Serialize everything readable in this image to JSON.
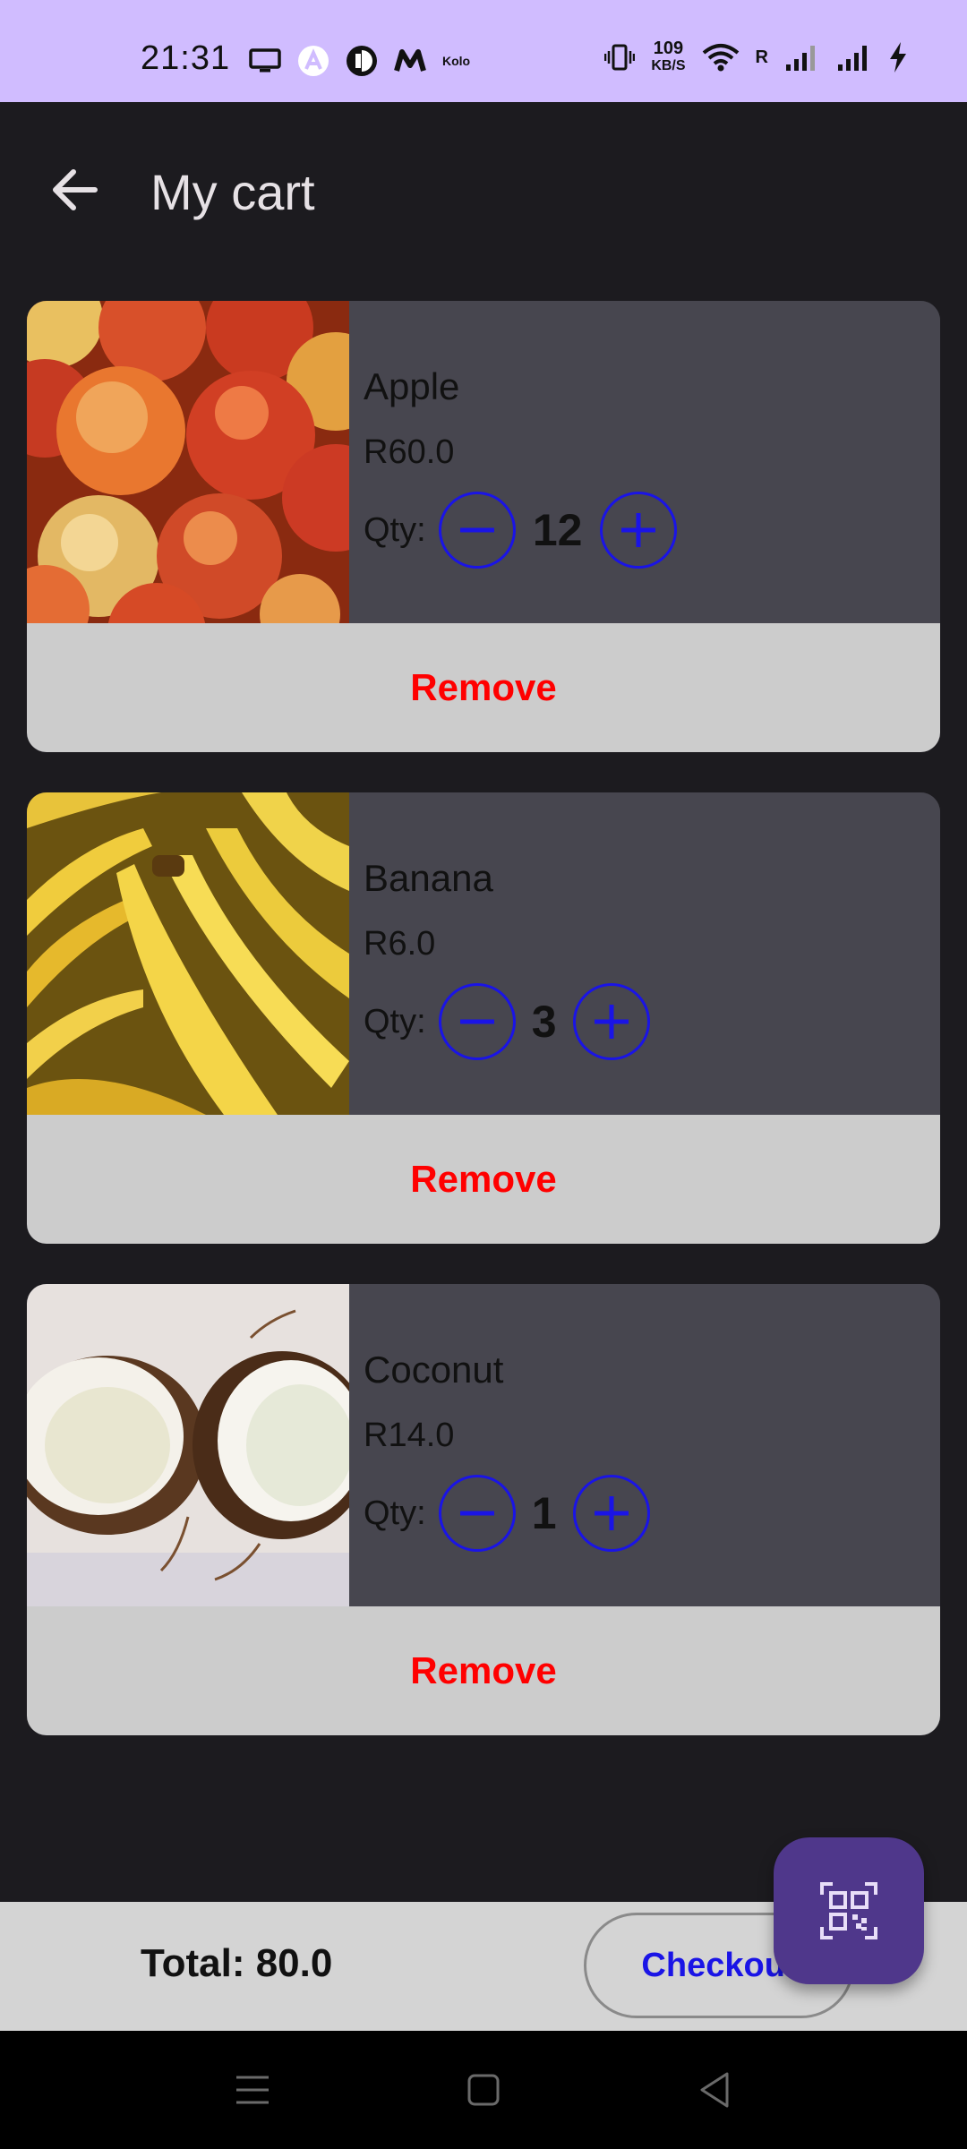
{
  "status_bar": {
    "time": "21:31",
    "net_speed_value": "109",
    "net_speed_unit": "KB/S",
    "kolo_label": "Kolo",
    "roaming_label": "R",
    "background_color": "#d0bcff"
  },
  "app_bar": {
    "title": "My cart"
  },
  "cart": {
    "items": [
      {
        "name": "Apple",
        "price": "R60.0",
        "qty_label": "Qty:",
        "quantity": "12",
        "remove_label": "Remove",
        "image_icon": "apples-photo"
      },
      {
        "name": "Banana",
        "price": "R6.0",
        "qty_label": "Qty:",
        "quantity": "3",
        "remove_label": "Remove",
        "image_icon": "bananas-photo"
      },
      {
        "name": "Coconut",
        "price": "R14.0",
        "qty_label": "Qty:",
        "quantity": "1",
        "remove_label": "Remove",
        "image_icon": "coconut-photo"
      }
    ]
  },
  "footer": {
    "total_text": "Total: 80.0",
    "checkout_label": "Checkout"
  },
  "fab": {
    "icon": "qr-code-scan-icon",
    "color": "#4f378b"
  },
  "colors": {
    "accent_blue": "#1a14e6",
    "remove_red": "#ff0000",
    "card_background": "#47464f",
    "card_footer": "#cccccc"
  }
}
